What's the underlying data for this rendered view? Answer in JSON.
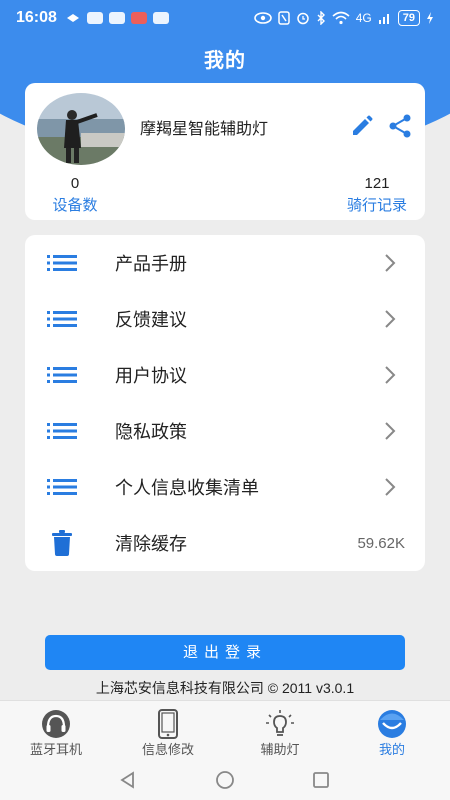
{
  "status_bar": {
    "time": "16:08",
    "battery": "79",
    "network": "4G"
  },
  "header": {
    "title": "我的"
  },
  "profile": {
    "username": "摩羯星智能辅助灯",
    "devices_count": "0",
    "devices_label": "设备数",
    "rides_count": "121",
    "rides_label": "骑行记录"
  },
  "menu": {
    "items": [
      {
        "label": "产品手册",
        "icon": "list-icon"
      },
      {
        "label": "反馈建议",
        "icon": "list-icon"
      },
      {
        "label": "用户协议",
        "icon": "list-icon"
      },
      {
        "label": "隐私政策",
        "icon": "list-icon"
      },
      {
        "label": "个人信息收集清单",
        "icon": "list-icon"
      },
      {
        "label": "清除缓存",
        "icon": "trash-icon",
        "value": "59.62K"
      }
    ]
  },
  "logout_label": "退出登录",
  "copyright": "上海芯安信息科技有限公司 © 2011 v3.0.1",
  "bottom_nav": {
    "items": [
      {
        "label": "蓝牙耳机",
        "icon": "headphones-icon"
      },
      {
        "label": "信息修改",
        "icon": "tablet-icon"
      },
      {
        "label": "辅助灯",
        "icon": "lightbulb-icon"
      },
      {
        "label": "我的",
        "icon": "user-face-icon",
        "active": true
      }
    ]
  },
  "colors": {
    "accent": "#2a7de1",
    "header_blue": "#3c8ced",
    "button_blue": "#1f86f4"
  }
}
